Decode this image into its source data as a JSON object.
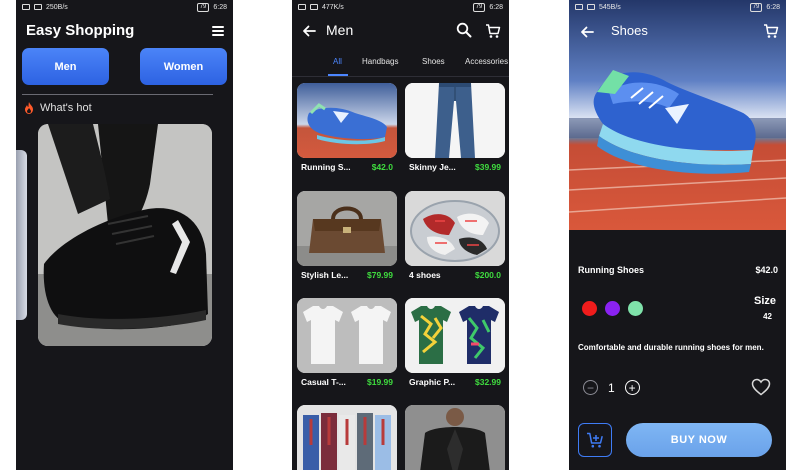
{
  "status_bar": [
    {
      "speed": "250B/s",
      "battery": "79",
      "time": "6:28"
    },
    {
      "speed": "477K/s",
      "battery": "79",
      "time": "6:28"
    },
    {
      "speed": "545B/s",
      "battery": "79",
      "time": "6:28"
    }
  ],
  "home": {
    "title": "Easy Shopping",
    "categories": [
      "Men",
      "Women"
    ],
    "section_title": "What's hot",
    "menu_icon": "hamburger-menu-icon",
    "hot_icon": "flame-icon"
  },
  "list": {
    "title": "Men",
    "tabs": [
      "All",
      "Handbags",
      "Shoes",
      "Accessories"
    ],
    "active_tab": "All",
    "products": [
      {
        "name": "Running S...",
        "price": "$42.0"
      },
      {
        "name": "Skinny Je...",
        "price": "$39.99"
      },
      {
        "name": "Stylish Le...",
        "price": "$79.99"
      },
      {
        "name": "4 shoes",
        "price": "$200.0"
      },
      {
        "name": "Casual T-...",
        "price": "$19.99"
      },
      {
        "name": "Graphic P...",
        "price": "$32.99"
      },
      {
        "name": "",
        "price": ""
      },
      {
        "name": "",
        "price": ""
      }
    ]
  },
  "detail": {
    "title": "Shoes",
    "product_name": "Running Shoes",
    "price": "$42.0",
    "colors": [
      "#f01c1c",
      "#8a22f2",
      "#7fe2aa"
    ],
    "size_label": "Size",
    "size_value": "42",
    "description": "Comfortable and durable running shoes for men.",
    "quantity": "1",
    "buy_label": "BUY NOW",
    "accent_color": "#3f7cf6"
  }
}
